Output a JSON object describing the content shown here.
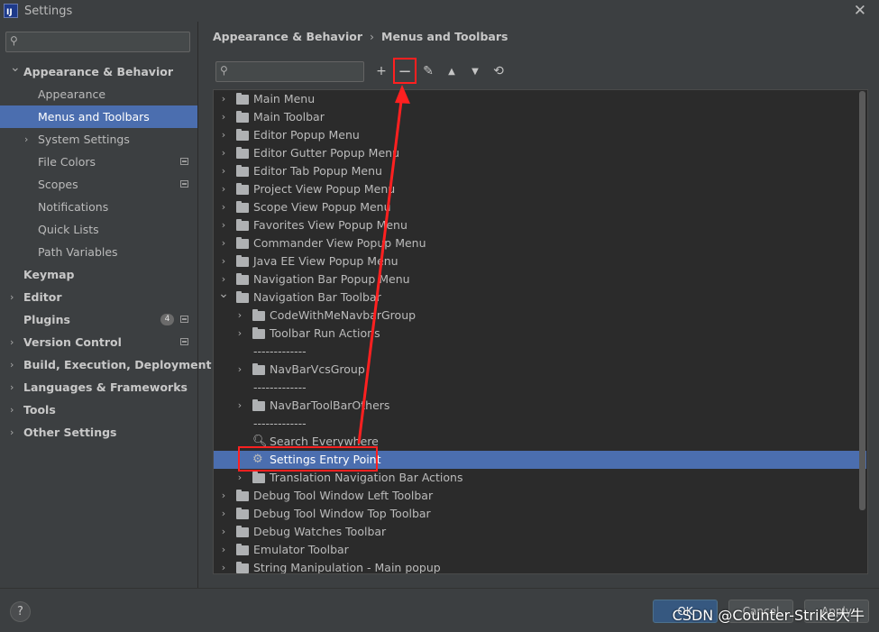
{
  "window": {
    "title": "Settings",
    "logo_text": "IJ"
  },
  "sidebar": {
    "search_placeholder": "",
    "items": [
      {
        "label": "Appearance & Behavior",
        "level": 0,
        "bold": true,
        "expanded": true
      },
      {
        "label": "Appearance",
        "level": 1
      },
      {
        "label": "Menus and Toolbars",
        "level": 1,
        "selected": true
      },
      {
        "label": "System Settings",
        "level": 1,
        "collapsed": true
      },
      {
        "label": "File Colors",
        "level": 1,
        "project_icon": true
      },
      {
        "label": "Scopes",
        "level": 1,
        "project_icon": true
      },
      {
        "label": "Notifications",
        "level": 1
      },
      {
        "label": "Quick Lists",
        "level": 1
      },
      {
        "label": "Path Variables",
        "level": 1
      },
      {
        "label": "Keymap",
        "level": 0,
        "bold": true
      },
      {
        "label": "Editor",
        "level": 0,
        "bold": true,
        "collapsed": true
      },
      {
        "label": "Plugins",
        "level": 0,
        "bold": true,
        "badge": "4",
        "project_icon": true
      },
      {
        "label": "Version Control",
        "level": 0,
        "bold": true,
        "collapsed": true,
        "project_icon": true
      },
      {
        "label": "Build, Execution, Deployment",
        "level": 0,
        "bold": true,
        "collapsed": true
      },
      {
        "label": "Languages & Frameworks",
        "level": 0,
        "bold": true,
        "collapsed": true
      },
      {
        "label": "Tools",
        "level": 0,
        "bold": true,
        "collapsed": true
      },
      {
        "label": "Other Settings",
        "level": 0,
        "bold": true,
        "collapsed": true
      }
    ]
  },
  "breadcrumb": {
    "parent": "Appearance & Behavior",
    "separator": "›",
    "current": "Menus and Toolbars"
  },
  "toolbar": {
    "search_placeholder": "",
    "buttons": [
      {
        "name": "add-button",
        "icon": "plus-icon",
        "glyph": "+"
      },
      {
        "name": "remove-button",
        "icon": "minus-icon",
        "glyph": "−"
      },
      {
        "name": "edit-icon-button",
        "icon": "pencil-icon",
        "glyph": "✎"
      },
      {
        "name": "move-up-button",
        "icon": "arrow-up-icon",
        "glyph": "▲"
      },
      {
        "name": "move-down-button",
        "icon": "arrow-down-icon",
        "glyph": "▼"
      },
      {
        "name": "restore-button",
        "icon": "restore-icon",
        "glyph": "⟲"
      }
    ]
  },
  "tree": [
    {
      "label": "Main Menu",
      "level": 0,
      "type": "folder",
      "expanded": false
    },
    {
      "label": "Main Toolbar",
      "level": 0,
      "type": "folder",
      "expanded": false
    },
    {
      "label": "Editor Popup Menu",
      "level": 0,
      "type": "folder",
      "expanded": false
    },
    {
      "label": "Editor Gutter Popup Menu",
      "level": 0,
      "type": "folder",
      "expanded": false
    },
    {
      "label": "Editor Tab Popup Menu",
      "level": 0,
      "type": "folder",
      "expanded": false
    },
    {
      "label": "Project View Popup Menu",
      "level": 0,
      "type": "folder",
      "expanded": false
    },
    {
      "label": "Scope View Popup Menu",
      "level": 0,
      "type": "folder",
      "expanded": false
    },
    {
      "label": "Favorites View Popup Menu",
      "level": 0,
      "type": "folder",
      "expanded": false
    },
    {
      "label": "Commander View Popup Menu",
      "level": 0,
      "type": "folder",
      "expanded": false
    },
    {
      "label": "Java EE View Popup Menu",
      "level": 0,
      "type": "folder",
      "expanded": false
    },
    {
      "label": "Navigation Bar Popup Menu",
      "level": 0,
      "type": "folder",
      "expanded": false
    },
    {
      "label": "Navigation Bar Toolbar",
      "level": 0,
      "type": "folder",
      "expanded": true
    },
    {
      "label": "CodeWithMeNavbarGroup",
      "level": 1,
      "type": "folder",
      "expanded": false
    },
    {
      "label": "Toolbar Run Actions",
      "level": 1,
      "type": "folder",
      "expanded": false
    },
    {
      "label": "-------------",
      "level": 1,
      "type": "separator"
    },
    {
      "label": "NavBarVcsGroup",
      "level": 1,
      "type": "folder",
      "expanded": false
    },
    {
      "label": "-------------",
      "level": 1,
      "type": "separator"
    },
    {
      "label": "NavBarToolBarOthers",
      "level": 1,
      "type": "folder",
      "expanded": false
    },
    {
      "label": "-------------",
      "level": 1,
      "type": "separator"
    },
    {
      "label": "Search Everywhere",
      "level": 1,
      "type": "action",
      "icon": "search-icon",
      "glyph": "🔍︎"
    },
    {
      "label": "Settings Entry Point",
      "level": 1,
      "type": "action",
      "icon": "gear-icon",
      "glyph": "⚙",
      "selected": true
    },
    {
      "label": "Translation Navigation Bar Actions",
      "level": 1,
      "type": "folder",
      "expanded": false
    },
    {
      "label": "Debug Tool Window Left Toolbar",
      "level": 0,
      "type": "folder",
      "expanded": false
    },
    {
      "label": "Debug Tool Window Top Toolbar",
      "level": 0,
      "type": "folder",
      "expanded": false
    },
    {
      "label": "Debug Watches Toolbar",
      "level": 0,
      "type": "folder",
      "expanded": false
    },
    {
      "label": "Emulator Toolbar",
      "level": 0,
      "type": "folder",
      "expanded": false
    },
    {
      "label": "String Manipulation - Main popup",
      "level": 0,
      "type": "folder",
      "expanded": false
    }
  ],
  "footer": {
    "help_label": "?",
    "ok_label": "OK",
    "cancel_label": "Cancel",
    "apply_label": "Apply",
    "watermark": "CSDN @Counter-Strike大牛"
  },
  "colors": {
    "selection": "#4b6eaf",
    "annotation": "#ff2020",
    "background": "#3c3f41",
    "tree_bg": "#2b2b2b"
  }
}
